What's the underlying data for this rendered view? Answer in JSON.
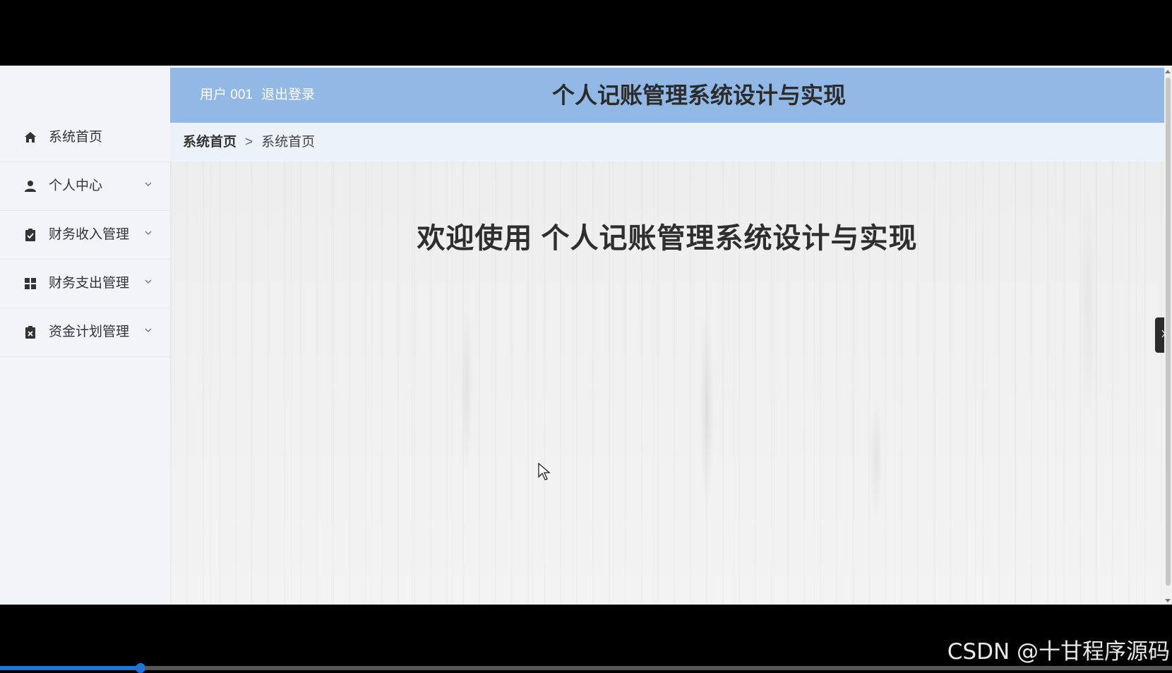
{
  "sidebar": {
    "items": [
      {
        "label": "系统首页",
        "icon": "home-icon",
        "has_submenu": false
      },
      {
        "label": "个人中心",
        "icon": "user-icon",
        "has_submenu": true
      },
      {
        "label": "财务收入管理",
        "icon": "clipboard-check-icon",
        "has_submenu": true
      },
      {
        "label": "财务支出管理",
        "icon": "grid-icon",
        "has_submenu": true
      },
      {
        "label": "资金计划管理",
        "icon": "clipboard-x-icon",
        "has_submenu": true
      }
    ]
  },
  "header": {
    "user_label": "用户 001",
    "logout_label": "退出登录",
    "title": "个人记账管理系统设计与实现"
  },
  "breadcrumb": {
    "root": "系统首页",
    "separator": ">",
    "current": "系统首页"
  },
  "main": {
    "welcome_text": "欢迎使用 个人记账管理系统设计与实现"
  },
  "overlay": {
    "watermark": "CSDN @十甘程序源码",
    "video_progress_fraction": 0.12
  },
  "colors": {
    "header_bg": "#92b9e6",
    "sidebar_bg": "#f2f4f7",
    "progress": "#1e73d9"
  }
}
